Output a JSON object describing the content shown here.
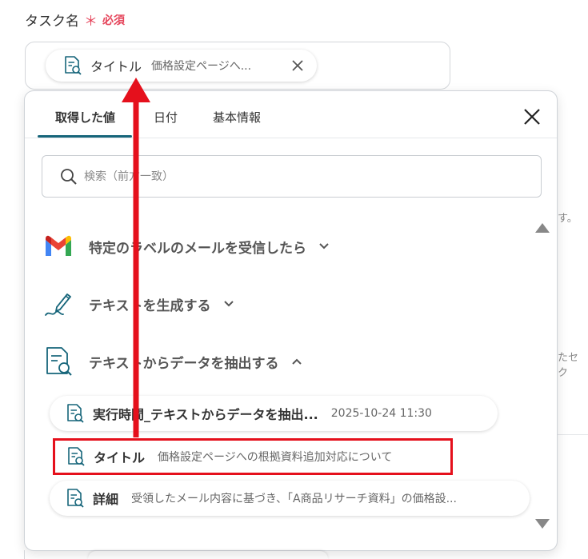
{
  "field": {
    "label": "タスク名",
    "required_mark": "＊",
    "required_text": "必須"
  },
  "selected_chip": {
    "label": "タイトル",
    "value": "価格設定ページへ..."
  },
  "background": {
    "text_right_1": "す。",
    "text_right_2": "たセク"
  },
  "popup": {
    "tabs": [
      {
        "label": "取得した値"
      },
      {
        "label": "日付"
      },
      {
        "label": "基本情報"
      }
    ],
    "search": {
      "placeholder": "検索（前方一致）"
    },
    "sections": [
      {
        "label": "特定のラベルのメールを受信したら",
        "icon": "gmail-icon",
        "expanded": false
      },
      {
        "label": "テキストを生成する",
        "icon": "pen-icon",
        "expanded": false
      },
      {
        "label": "テキストからデータを抽出する",
        "icon": "document-search-icon",
        "expanded": true
      }
    ],
    "items": [
      {
        "label": "実行時間_テキストからデータを抽出...",
        "value": "2025-10-24 11:30"
      },
      {
        "label": "タイトル",
        "value": "価格設定ページへの根拠資料追加対応について"
      },
      {
        "label": "詳細",
        "value": "受領したメール内容に基づき、「A商品リサーチ資料」の価格設..."
      }
    ]
  },
  "colors": {
    "accent": "#16657a",
    "required": "#e5455b",
    "annotation_red": "#e5101c"
  }
}
